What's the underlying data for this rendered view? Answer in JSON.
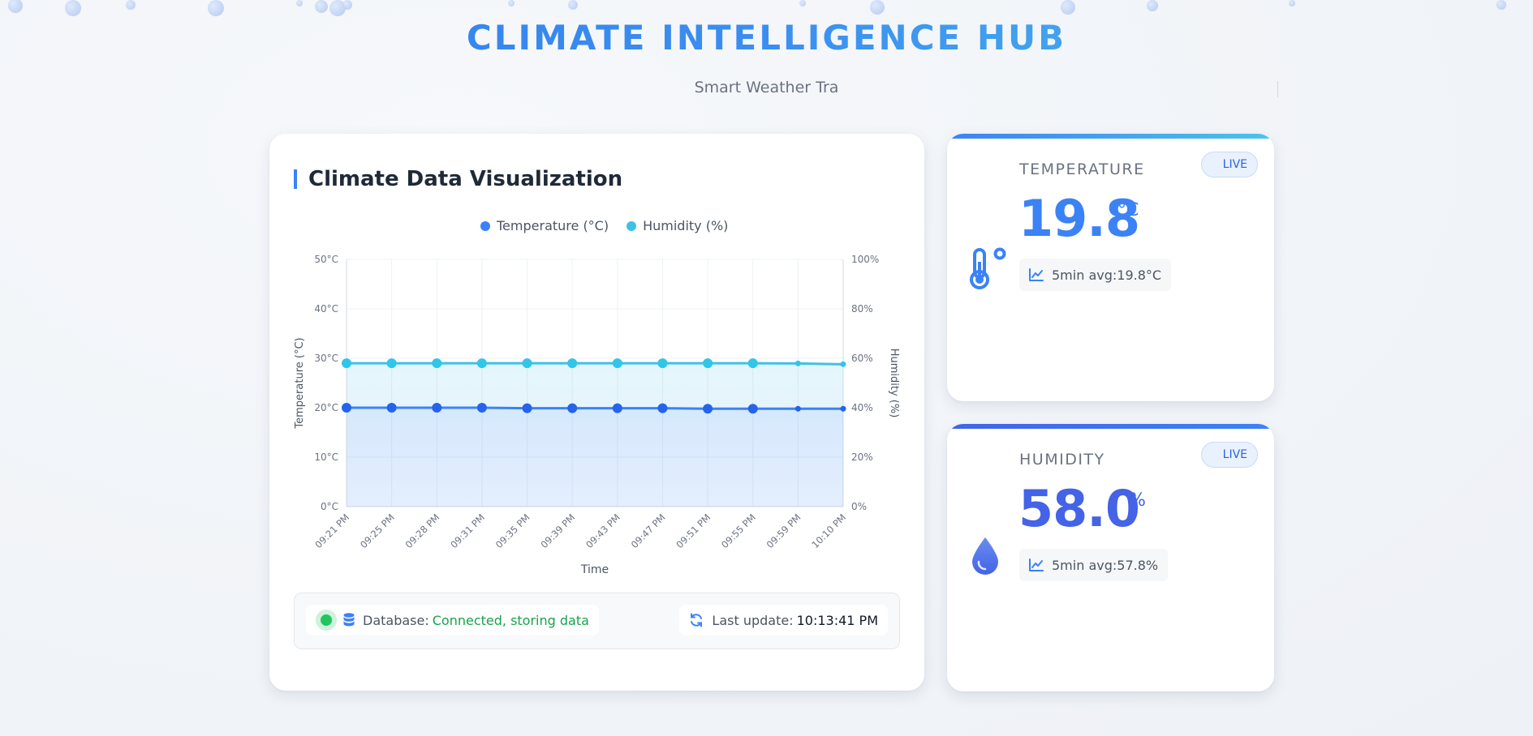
{
  "header": {
    "title": "CLIMATE INTELLIGENCE HUB",
    "subtitle": "Smart Weather Tra"
  },
  "chart_panel": {
    "heading": "Climate Data Visualization",
    "status": {
      "db_label": "Database:",
      "db_status": "Connected, storing data",
      "update_label": "Last update:",
      "update_time": "10:13:41 PM"
    }
  },
  "chart_data": {
    "type": "line",
    "xlabel": "Time",
    "ylabel": "Temperature (°C)",
    "y2label": "Humidity (%)",
    "x": [
      "09:21 PM",
      "09:25 PM",
      "09:28 PM",
      "09:31 PM",
      "09:35 PM",
      "09:39 PM",
      "09:43 PM",
      "09:47 PM",
      "09:51 PM",
      "09:55 PM",
      "09:59 PM",
      "10:10 PM"
    ],
    "ylim": [
      0,
      50
    ],
    "y2lim": [
      0,
      100
    ],
    "y_ticks": [
      "0°C",
      "10°C",
      "20°C",
      "30°C",
      "40°C",
      "50°C"
    ],
    "y2_ticks": [
      "0%",
      "20%",
      "40%",
      "60%",
      "80%",
      "100%"
    ],
    "legend_position": "top-center",
    "grid": true,
    "series": [
      {
        "name": "Temperature (°C)",
        "axis": "left",
        "color": "#3b82f6",
        "values": [
          20.0,
          20.0,
          20.0,
          20.0,
          19.9,
          19.9,
          19.9,
          19.9,
          19.8,
          19.8,
          19.8,
          19.8
        ]
      },
      {
        "name": "Humidity (%)",
        "axis": "right",
        "color": "#3fc1e6",
        "values": [
          58.0,
          58.0,
          58.0,
          58.0,
          58.0,
          58.0,
          58.0,
          58.0,
          58.0,
          58.0,
          57.9,
          57.6
        ]
      }
    ]
  },
  "temperature": {
    "label": "TEMPERATURE",
    "value": "19.8",
    "unit": "°C",
    "avg": "5min avg:19.8°C",
    "badge": "LIVE",
    "color": "#3b82f6"
  },
  "humidity": {
    "label": "HUMIDITY",
    "value": "58.0",
    "unit": "%",
    "avg": "5min avg:57.8%",
    "badge": "LIVE",
    "color": "#4463e6"
  },
  "icons": [
    "thermometer-icon",
    "droplet-icon",
    "chart-line-icon",
    "database-icon",
    "refresh-icon"
  ]
}
